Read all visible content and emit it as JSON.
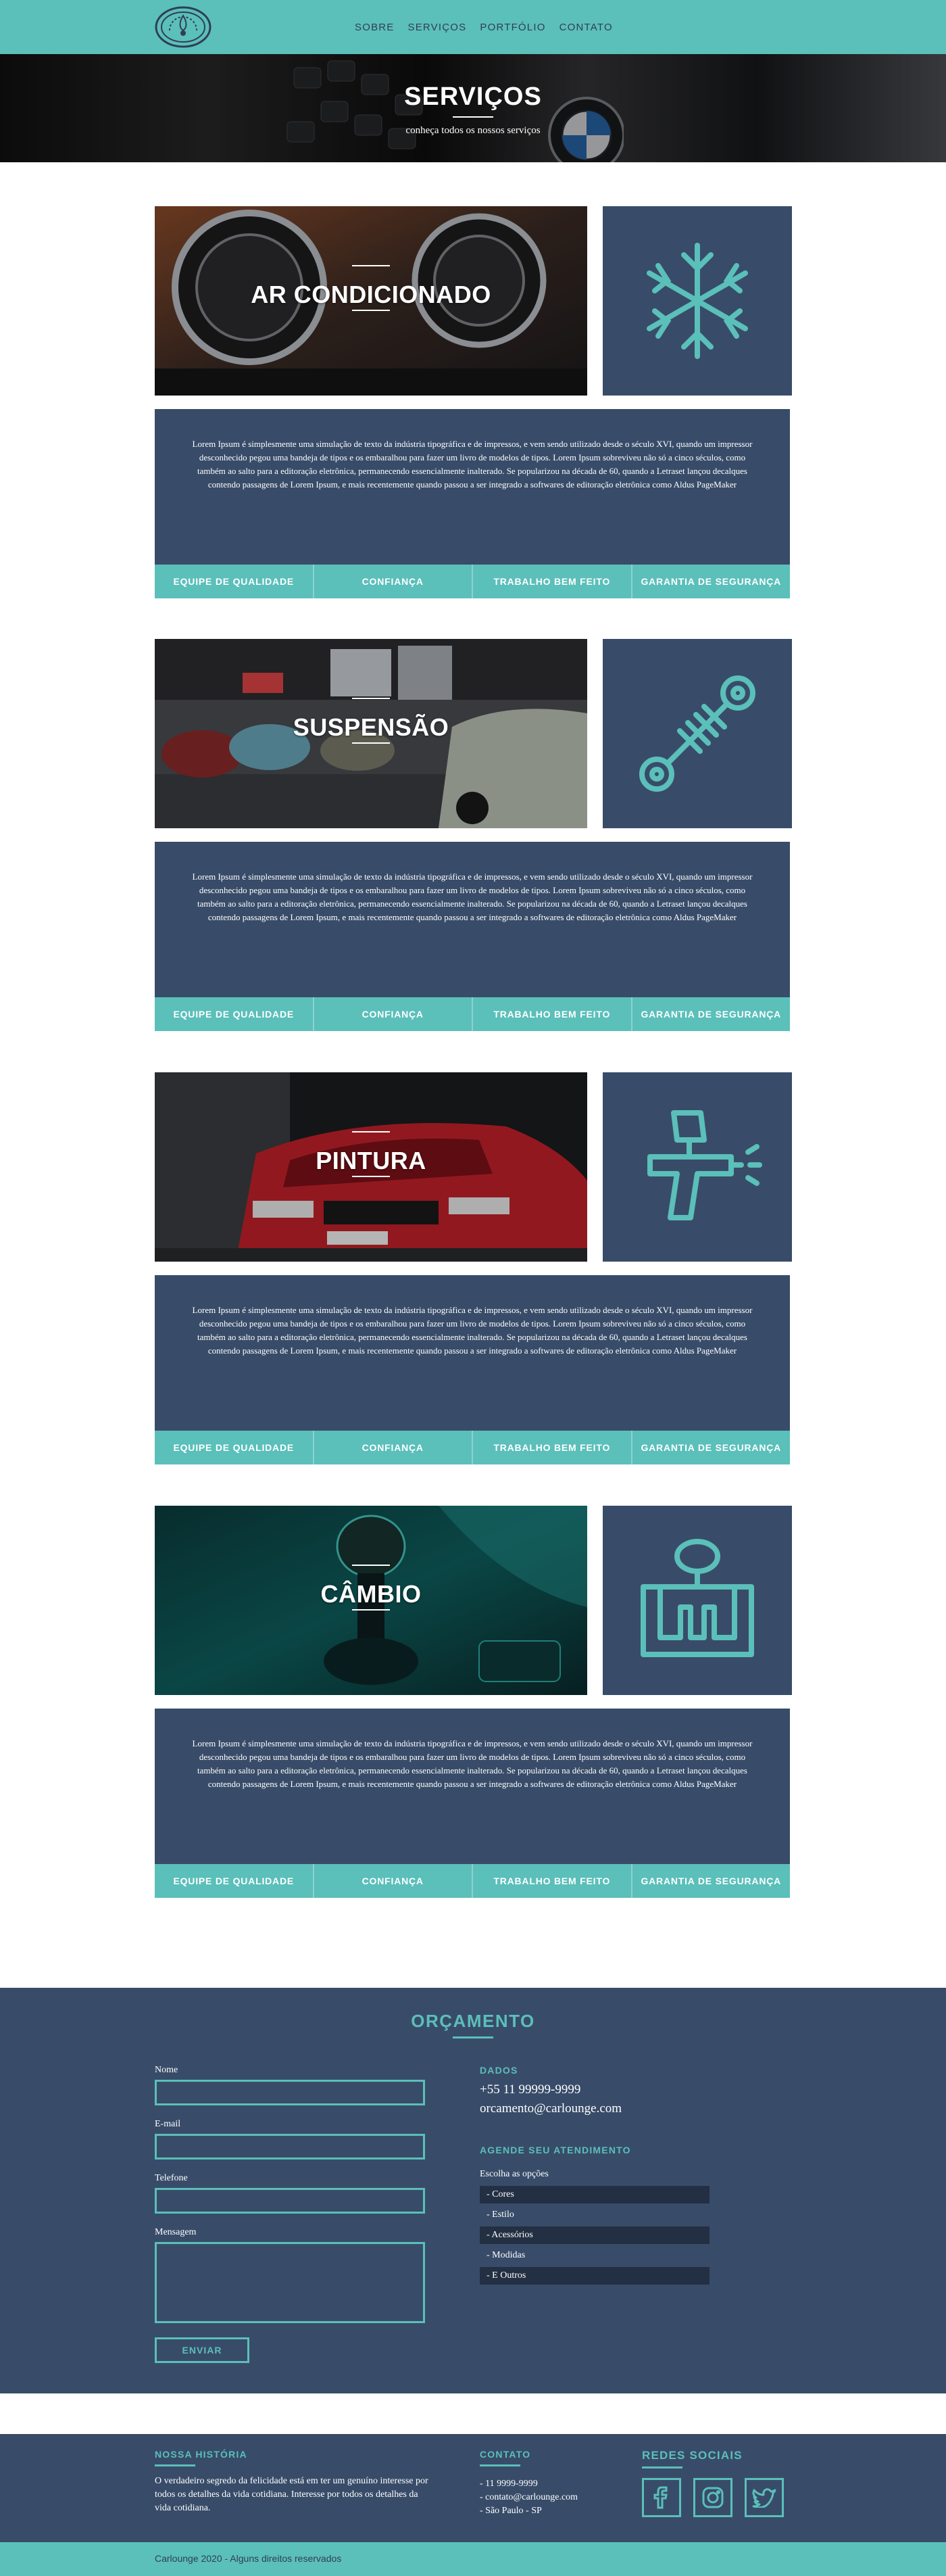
{
  "header": {
    "logo": "gauge-logo",
    "nav": [
      "SOBRE",
      "SERVIÇOS",
      "PORTFÓLIO",
      "CONTATO"
    ]
  },
  "hero": {
    "title": "SERVIÇOS",
    "subtitle": "conheça todos os nossos serviços"
  },
  "services": [
    {
      "title": "AR CONDICIONADO",
      "icon": "snowflake-icon",
      "text": "Lorem Ipsum é simplesmente uma simulação de texto da indústria tipográfica e de impressos, e vem sendo utilizado desde o século XVI, quando um impressor desconhecido pegou uma bandeja de tipos e os embaralhou para fazer um livro de modelos de tipos. Lorem Ipsum sobreviveu não só a cinco séculos, como também ao salto para a editoração eletrônica, permanecendo essencialmente inalterado. Se popularizou na década de 60, quando a Letraset lançou decalques contendo passagens de Lorem Ipsum, e mais recentemente quando passou a ser integrado a softwares de editoração eletrônica como Aldus PageMaker",
      "features": [
        "EQUIPE DE QUALIDADE",
        "CONFIANÇA",
        "TRABALHO BEM FEITO",
        "GARANTIA DE SEGURANÇA"
      ]
    },
    {
      "title": "SUSPENSÃO",
      "icon": "suspension-icon",
      "text": "Lorem Ipsum é simplesmente uma simulação de texto da indústria tipográfica e de impressos, e vem sendo utilizado desde o século XVI, quando um impressor desconhecido pegou uma bandeja de tipos e os embaralhou para fazer um livro de modelos de tipos. Lorem Ipsum sobreviveu não só a cinco séculos, como também ao salto para a editoração eletrônica, permanecendo essencialmente inalterado. Se popularizou na década de 60, quando a Letraset lançou decalques contendo passagens de Lorem Ipsum, e mais recentemente quando passou a ser integrado a softwares de editoração eletrônica como Aldus PageMaker",
      "features": [
        "EQUIPE DE QUALIDADE",
        "CONFIANÇA",
        "TRABALHO BEM FEITO",
        "GARANTIA DE SEGURANÇA"
      ]
    },
    {
      "title": "PINTURA",
      "icon": "spray-gun-icon",
      "text": "Lorem Ipsum é simplesmente uma simulação de texto da indústria tipográfica e de impressos, e vem sendo utilizado desde o século XVI, quando um impressor desconhecido pegou uma bandeja de tipos e os embaralhou para fazer um livro de modelos de tipos. Lorem Ipsum sobreviveu não só a cinco séculos, como também ao salto para a editoração eletrônica, permanecendo essencialmente inalterado. Se popularizou na década de 60, quando a Letraset lançou decalques contendo passagens de Lorem Ipsum, e mais recentemente quando passou a ser integrado a softwares de editoração eletrônica como Aldus PageMaker",
      "features": [
        "EQUIPE DE QUALIDADE",
        "CONFIANÇA",
        "TRABALHO BEM FEITO",
        "GARANTIA DE SEGURANÇA"
      ]
    },
    {
      "title": "CÂMBIO",
      "icon": "gear-shift-icon",
      "text": "Lorem Ipsum é simplesmente uma simulação de texto da indústria tipográfica e de impressos, e vem sendo utilizado desde o século XVI, quando um impressor desconhecido pegou uma bandeja de tipos e os embaralhou para fazer um livro de modelos de tipos. Lorem Ipsum sobreviveu não só a cinco séculos, como também ao salto para a editoração eletrônica, permanecendo essencialmente inalterado. Se popularizou na década de 60, quando a Letraset lançou decalques contendo passagens de Lorem Ipsum, e mais recentemente quando passou a ser integrado a softwares de editoração eletrônica como Aldus PageMaker",
      "features": [
        "EQUIPE DE QUALIDADE",
        "CONFIANÇA",
        "TRABALHO BEM FEITO",
        "GARANTIA DE SEGURANÇA"
      ]
    }
  ],
  "quote": {
    "title": "ORÇAMENTO",
    "form": {
      "name_label": "Nome",
      "email_label": "E-mail",
      "phone_label": "Telefone",
      "message_label": "Mensagem",
      "submit": "ENVIAR"
    },
    "data_heading": "DADOS",
    "phone": "+55 11 99999-9999",
    "email": "orcamento@carlounge.com",
    "schedule_heading": "AGENDE SEU ATENDIMENTO",
    "schedule_prompt": "Escolha as opções",
    "options": [
      "- Cores",
      "- Estilo",
      "- Acessórios",
      "- Modidas",
      "- E Outros"
    ]
  },
  "footer": {
    "history_heading": "NOSSA HISTÓRIA",
    "history_text": "O verdadeiro segredo da felicidade está em ter um genuíno interesse por todos os detalhes da vida cotidiana. Interesse por todos os detalhes da vida cotidiana.",
    "contact_heading": "CONTATO",
    "contact_lines": [
      "- 11 9999-9999",
      "- contato@carlounge.com",
      "- São Paulo - SP"
    ],
    "social_heading": "REDES SOCIAIS",
    "social_icons": [
      "facebook-icon",
      "instagram-icon",
      "twitter-icon"
    ],
    "copyright": "Carlounge 2020 - Alguns direitos reservados"
  },
  "colors": {
    "teal": "#5bbfba",
    "navy": "#384c69",
    "dark_option": "#232f42"
  }
}
